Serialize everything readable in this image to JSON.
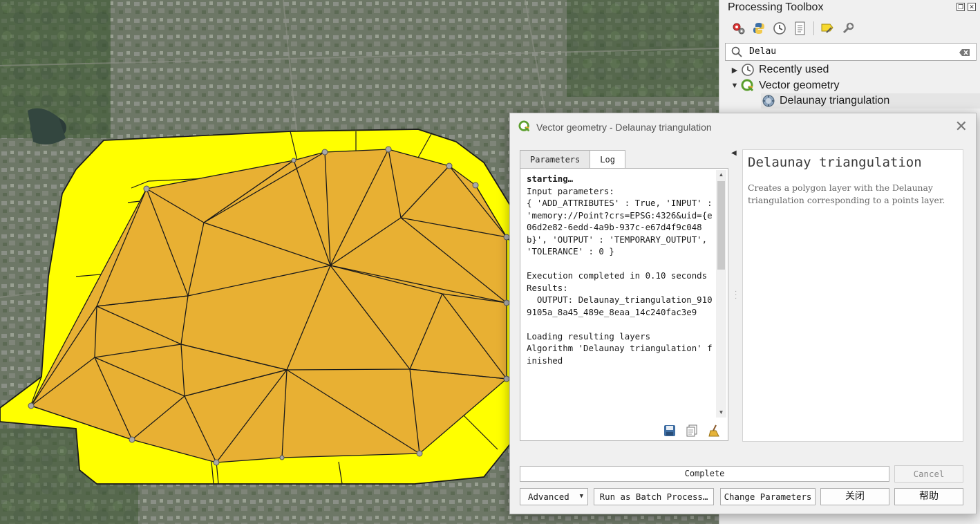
{
  "toolbox": {
    "title": "Processing Toolbox",
    "toolbar_icons": [
      "models-icon",
      "python-icon",
      "history-icon",
      "results-icon",
      "edit-features-icon",
      "options-icon"
    ],
    "search": {
      "value": "Delau"
    },
    "tree": [
      {
        "label": "Recently used",
        "icon": "clock-icon",
        "expanded": false
      },
      {
        "label": "Vector geometry",
        "icon": "qgis-icon",
        "expanded": true
      },
      {
        "label": "Delaunay triangulation",
        "icon": "algorithm-icon",
        "selected": true
      }
    ]
  },
  "dialog": {
    "title": "Vector geometry - Delaunay triangulation",
    "tabs": {
      "parameters": "Parameters",
      "log": "Log"
    },
    "log": {
      "starting": "starting…",
      "lines": [
        "Input parameters:",
        "{ 'ADD_ATTRIBUTES' : True, 'INPUT' : 'memory://Point?crs=EPSG:4326&uid={e06d2e82-6edd-4a9b-937c-e67d4f9c048b}', 'OUTPUT' : 'TEMPORARY_OUTPUT', 'TOLERANCE' : 0 }",
        "",
        "Execution completed in 0.10 seconds",
        "Results:",
        "  OUTPUT: Delaunay_triangulation_9109105a_8a45_489e_8eaa_14c240fac3e9",
        "",
        "Loading resulting layers",
        "Algorithm 'Delaunay triangulation' finished"
      ]
    },
    "help": {
      "title": "Delaunay triangulation",
      "description": "Creates a polygon layer with the Delaunay triangulation corresponding to a points layer."
    },
    "progress_text": "Complete",
    "buttons": {
      "cancel": "Cancel",
      "advanced": "Advanced",
      "batch": "Run as Batch Process…",
      "change_params": "Change Parameters",
      "close": "关闭",
      "help": "帮助"
    }
  },
  "colors": {
    "boundary_fill": "#ffff00",
    "triangle_fill": "#e8b033",
    "edge": "#1a1a1a",
    "vertex": "#a9a9a9"
  }
}
